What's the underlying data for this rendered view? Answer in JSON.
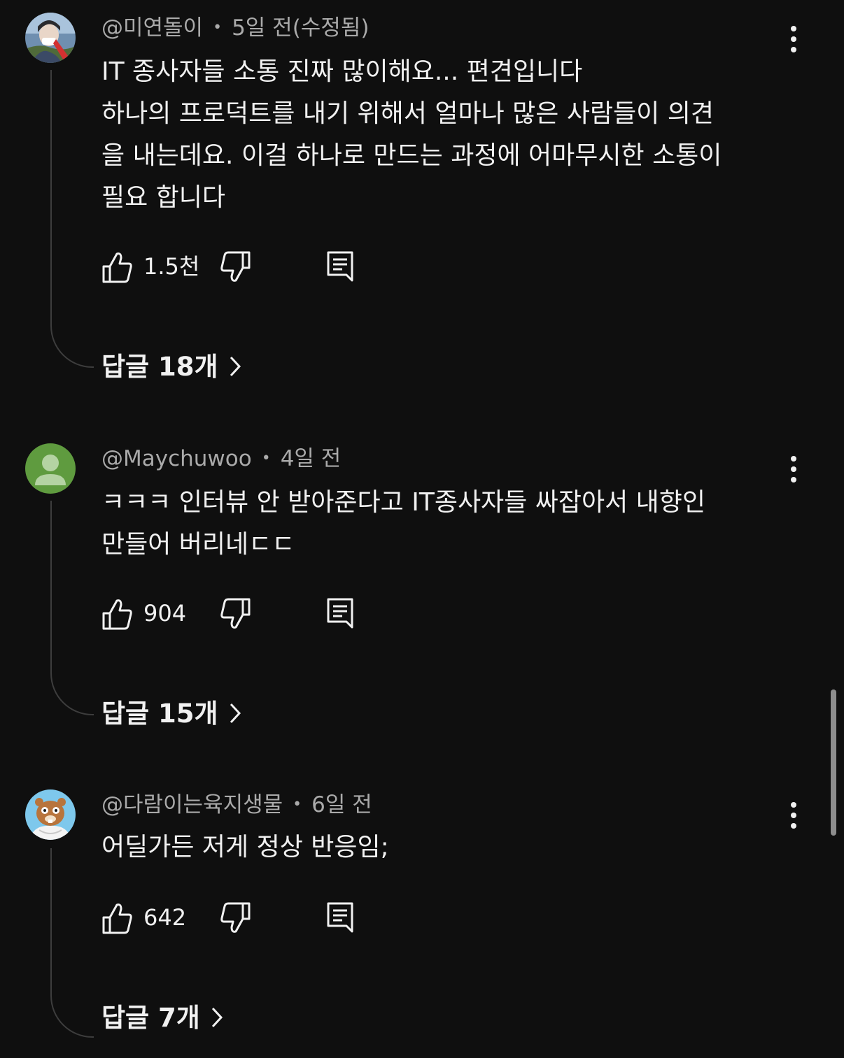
{
  "comments": [
    {
      "author": "@미연돌이",
      "time": "5일 전(수정됨)",
      "lines": [
        "IT 종사자들 소통 진짜 많이해요... 편견입니다",
        "하나의 프로덕트를 내기 위해서 얼마나 많은 사람들이 의견",
        "을 내는데요. 이걸 하나로 만드는 과정에 어마무시한 소통이",
        "필요 합니다"
      ],
      "likes": "1.5천",
      "replies": "답글 18개"
    },
    {
      "author": "@Maychuwoo",
      "time": "4일 전",
      "lines": [
        "ㅋㅋㅋ 인터뷰 안 받아준다고 IT종사자들 싸잡아서 내향인",
        "만들어 버리네ㄷㄷ"
      ],
      "likes": "904",
      "replies": "답글 15개"
    },
    {
      "author": "@다람이는육지생물",
      "time": "6일 전",
      "lines": [
        "어딜가든 저게 정상 반응임;"
      ],
      "likes": "642",
      "replies": "답글 7개"
    }
  ],
  "separator": "•",
  "colors": {
    "background": "#0f0f0f",
    "primary_text": "#f1f1f1",
    "secondary_text": "#aaaaaa",
    "thread_line": "#3d3d3d",
    "default_avatar": "#5f9b3f"
  },
  "icons": [
    "like-icon",
    "dislike-icon",
    "reply-icon",
    "more-vert-icon",
    "chevron-right-icon"
  ]
}
